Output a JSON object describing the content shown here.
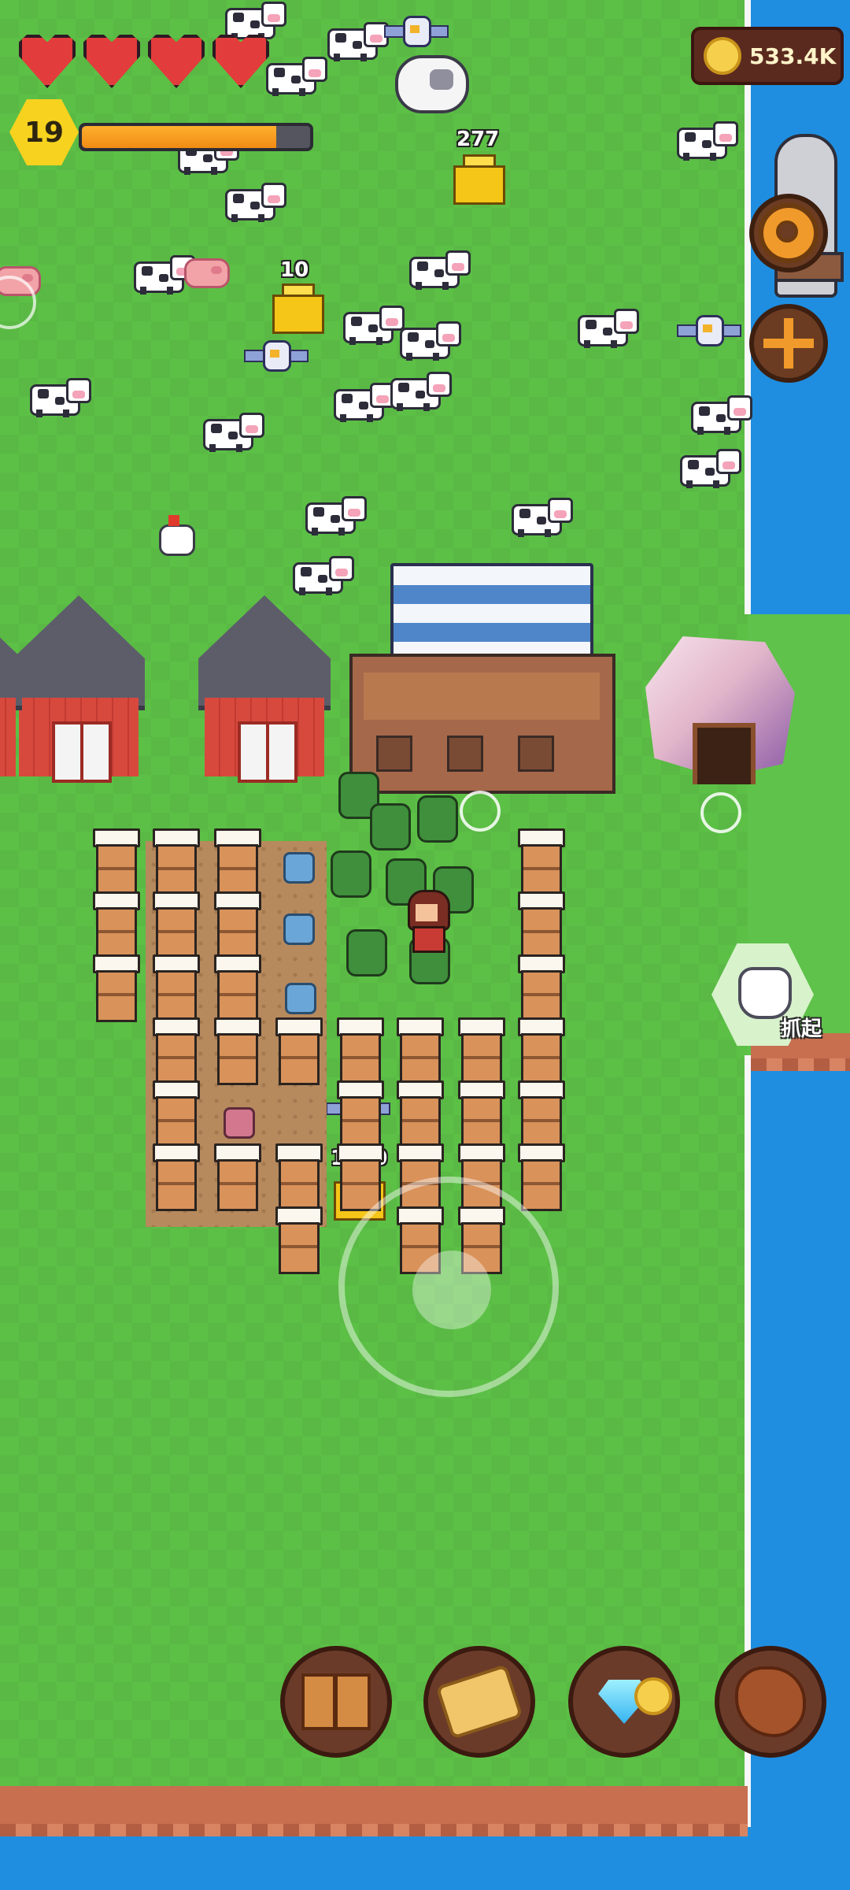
{
  "hud": {
    "hearts": 4,
    "level": "19",
    "xp_progress": 0.85,
    "coins": "533.4K"
  },
  "world": {
    "drop_labels": [
      "277",
      "10",
      "1820"
    ],
    "grab_label": "抓起"
  },
  "buttons": {
    "settings_icon": "gear-icon",
    "move_icon": "move-arrows-icon",
    "dock": [
      "book-icon",
      "scroll-map-icon",
      "gem-and-coin-icon",
      "leather-icon"
    ]
  },
  "colors": {
    "grass": "#5cc046",
    "sea": "#1f8ee0",
    "heart": "#e23c3c",
    "level_badge": "#f7d21f",
    "xp_fill": "#f08b14"
  }
}
